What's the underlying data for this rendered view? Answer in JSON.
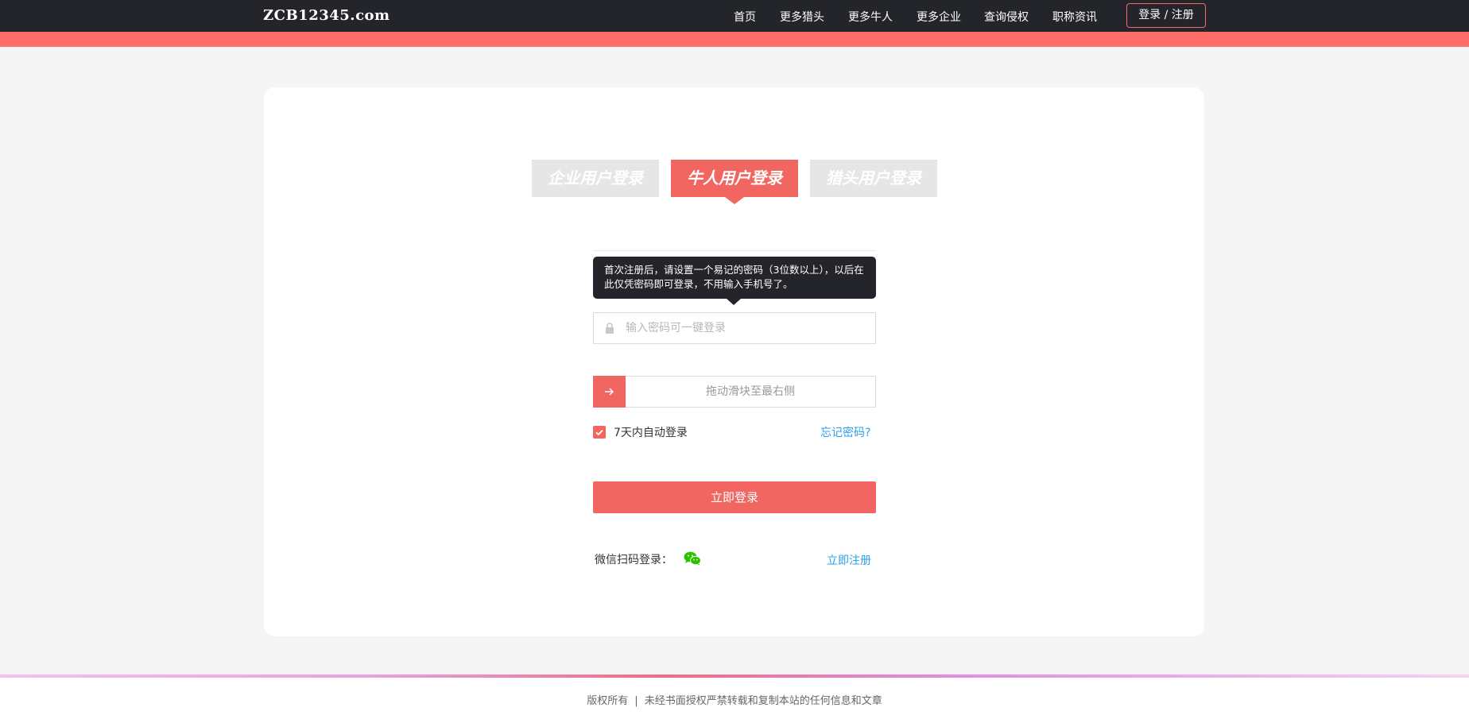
{
  "header": {
    "logo": "ZCB12345.com",
    "nav": [
      {
        "label": "首页"
      },
      {
        "label": "更多猎头"
      },
      {
        "label": "更多牛人"
      },
      {
        "label": "更多企业"
      },
      {
        "label": "查询侵权"
      },
      {
        "label": "职称资讯"
      }
    ],
    "login_button": "登录 / 注册"
  },
  "login": {
    "tabs": [
      {
        "label": "企业用户登录",
        "active": false
      },
      {
        "label": "牛人用户登录",
        "active": true
      },
      {
        "label": "猎头用户登录",
        "active": false
      }
    ],
    "tooltip": "首次注册后，请设置一个易记的密码（3位数以上），以后在此仅凭密码即可登录，不用输入手机号了。",
    "password": {
      "placeholder": "输入密码可一键登录",
      "value": "",
      "icon": "lock-icon"
    },
    "slider": {
      "text": "拖动滑块至最右侧",
      "icon": "arrow-right-icon"
    },
    "remember": {
      "label": "7天内自动登录",
      "checked": true
    },
    "forgot": "忘记密码?",
    "submit": "立即登录",
    "wechat_label": "微信扫码登录：",
    "register": "立即注册"
  },
  "footer": {
    "left": "版权所有",
    "separator": "|",
    "right": "未经书面授权严禁转载和复制本站的任何信息和文章"
  },
  "colors": {
    "header_bg": "#23252b",
    "accent": "#f16660",
    "link": "#2aa0ea",
    "tab_inactive": "#e6e6e6",
    "wechat": "#2dc100"
  }
}
